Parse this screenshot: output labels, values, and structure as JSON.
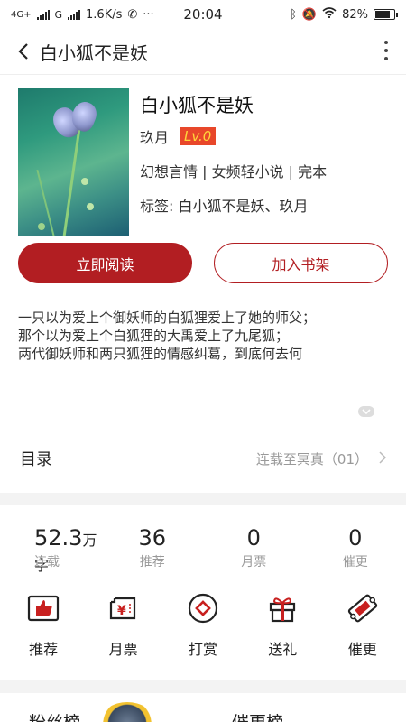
{
  "status_bar": {
    "network_left": "4G+",
    "network_right": "G",
    "speed": "1.6K/s",
    "time": "20:04",
    "battery": "82%",
    "battery_level": 0.82,
    "icons": [
      "call-icon",
      "more-dots-icon",
      "bluetooth-icon",
      "mute-icon",
      "wifi-icon",
      "battery-icon"
    ]
  },
  "header": {
    "title": "白小狐不是妖"
  },
  "book": {
    "name": "白小狐不是妖",
    "author": "玖月",
    "level": "Lv.0",
    "categories": "幻想言情 | 女频轻小说 | 完本",
    "tags": "标签:  白小狐不是妖、玖月"
  },
  "buttons": {
    "read": "立即阅读",
    "shelf": "加入书架"
  },
  "description": [
    "一只以为爱上个御妖师的白狐狸爱上了她的师父；",
    "那个以为爱上个白狐狸的大禹爱上了九尾狐；",
    "两代御妖师和两只狐狸的情感纠葛，到底何去何"
  ],
  "toc": {
    "label": "目录",
    "latest": "连载至冥真（01）"
  },
  "stats": [
    {
      "num": "52.3",
      "unit": "万字",
      "label": "连载"
    },
    {
      "num": "36",
      "unit": "",
      "label": "推荐"
    },
    {
      "num": "0",
      "unit": "",
      "label": "月票"
    },
    {
      "num": "0",
      "unit": "",
      "label": "催更"
    }
  ],
  "actions": [
    {
      "label": "推荐",
      "icon": "thumbs-up-ticket-icon"
    },
    {
      "label": "月票",
      "icon": "yuan-ticket-icon"
    },
    {
      "label": "打赏",
      "icon": "reward-coin-icon"
    },
    {
      "label": "送礼",
      "icon": "gift-icon"
    },
    {
      "label": "催更",
      "icon": "urge-ticket-icon"
    }
  ],
  "rank": {
    "fans": "粉丝榜",
    "urge": "催更榜"
  },
  "colors": {
    "accent": "#b21e22",
    "level_badge": "#e8472a"
  }
}
